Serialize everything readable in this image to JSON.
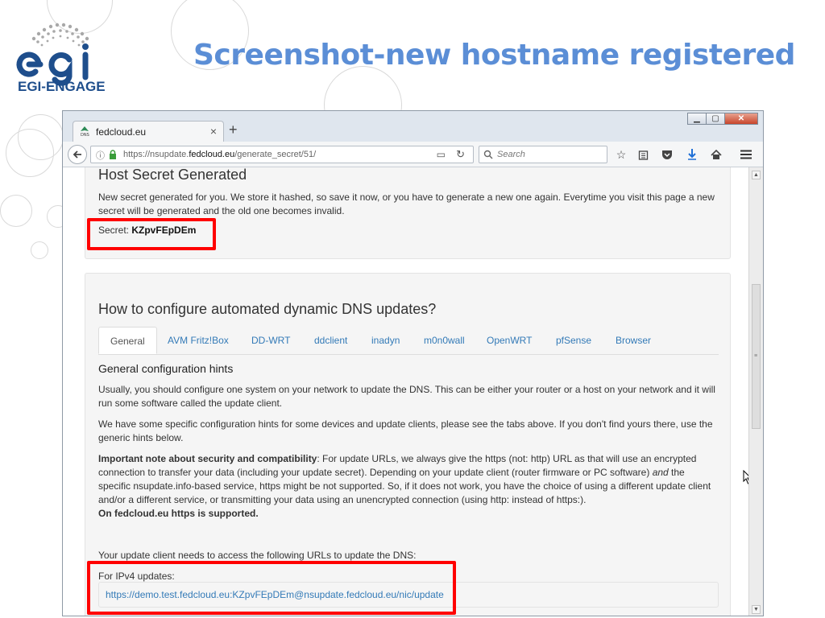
{
  "slide": {
    "title": "Screenshot-new hostname registered",
    "logo_text": "EGI-ENGAGE"
  },
  "browser": {
    "tab_title": "fedcloud.eu",
    "url_prefix": "https://nsupdate.",
    "url_domain": "fedcloud.eu",
    "url_path": "/generate_secret/51/",
    "search_placeholder": "Search"
  },
  "secret_panel": {
    "heading": "Host Secret Generated",
    "description": "New secret generated for you. We store it hashed, so save it now, or you have to generate a new one again. Everytime you visit this page a new secret will be generated and the old one becomes invalid.",
    "secret_label": "Secret:",
    "secret_value": "KZpvFEpDEm"
  },
  "config_panel": {
    "heading": "How to configure automated dynamic DNS updates?",
    "tabs": [
      "General",
      "AVM Fritz!Box",
      "DD-WRT",
      "ddclient",
      "inadyn",
      "m0n0wall",
      "OpenWRT",
      "pfSense",
      "Browser"
    ],
    "hints_heading": "General configuration hints",
    "para1": "Usually, you should configure one system on your network to update the DNS. This can be either your router or a host on your network and it will run some software called the update client.",
    "para2": "We have some specific configuration hints for some devices and update clients, please see the tabs above. If you don't find yours there, use the generic hints below.",
    "note_bold": "Important note about security and compatibility",
    "note_a": ": For update URLs, we always give the https (not: http) URL as that will use an encrypted connection to transfer your data (including your update secret). Depending on your update client (router firmware or PC software) ",
    "note_and": "and",
    "note_b": " the specific nsupdate.info-based service, https might be not supported. So, if it does not work, you have the choice of using a different update client and/or a different service, or transmitting your data using an unencrypted connection (using http: instead of https:).",
    "note_supported": "On fedcloud.eu https is supported.",
    "urls_intro": "Your update client needs to access the following URLs to update the DNS:",
    "ipv4_label": "For IPv4 updates:",
    "ipv4_url": "https://demo.test.fedcloud.eu:KZpvFEpDEm@nsupdate.fedcloud.eu/nic/update"
  },
  "colors": {
    "title_blue": "#5b8ed6",
    "logo_blue": "#1e4e8c",
    "link_blue": "#337ab7",
    "highlight_red": "#ff0000"
  }
}
